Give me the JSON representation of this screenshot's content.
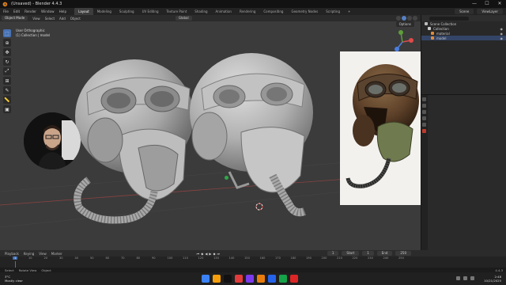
{
  "window": {
    "title": "(Unsaved) - Blender 4.4.3",
    "controls": [
      "—",
      "☐",
      "✕"
    ]
  },
  "menu": [
    "File",
    "Edit",
    "Render",
    "Window",
    "Help"
  ],
  "workspaces": [
    {
      "label": "Layout",
      "active": true
    },
    {
      "label": "Modeling",
      "active": false
    },
    {
      "label": "Sculpting",
      "active": false
    },
    {
      "label": "UV Editing",
      "active": false
    },
    {
      "label": "Texture Paint",
      "active": false
    },
    {
      "label": "Shading",
      "active": false
    },
    {
      "label": "Animation",
      "active": false
    },
    {
      "label": "Rendering",
      "active": false
    },
    {
      "label": "Compositing",
      "active": false
    },
    {
      "label": "Geometry Nodes",
      "active": false
    },
    {
      "label": "Scripting",
      "active": false
    },
    {
      "label": "+",
      "active": false
    }
  ],
  "scene": {
    "name": "Scene",
    "view_layer": "ViewLayer"
  },
  "viewport": {
    "mode": "Object Mode",
    "menu": [
      "View",
      "Select",
      "Add",
      "Object"
    ],
    "orientation": "Global",
    "options": "Options",
    "info_line1": "User Orthographic",
    "info_line2": "(1) Collection | model",
    "tools": [
      "select",
      "cursor",
      "move",
      "rotate",
      "scale",
      "transform",
      "annotate",
      "measure",
      "add-cube"
    ]
  },
  "outliner": {
    "rows": [
      {
        "label": "Scene Collection",
        "color": "#bbbbbb",
        "selected": false
      },
      {
        "label": "Collection",
        "color": "#cccccc",
        "selected": false
      },
      {
        "label": "material",
        "color": "#e08b3a",
        "selected": false
      },
      {
        "label": "model",
        "color": "#e08b3a",
        "selected": true
      }
    ]
  },
  "timeline": {
    "menu": [
      "Playback",
      "Keying",
      "View",
      "Marker"
    ],
    "current_frame": "1",
    "start_label": "Start",
    "start": "1",
    "end_label": "End",
    "end": "250",
    "ticks": [
      "10",
      "20",
      "30",
      "40",
      "50",
      "60",
      "70",
      "80",
      "90",
      "100",
      "110",
      "120",
      "130",
      "140",
      "150",
      "160",
      "170",
      "180",
      "190",
      "200",
      "210",
      "220",
      "230",
      "240",
      "250"
    ]
  },
  "statusbar": {
    "left": "Select",
    "middle": "Rotate View",
    "right": "Object",
    "version": "4.4.3"
  },
  "taskbar": {
    "temp": "3°C",
    "weather": "Mostly clear",
    "time": "2:48",
    "date": "10/21/2025",
    "app_colors": [
      "#3b82f6",
      "#f59e0b",
      "#111111",
      "#e23b3b",
      "#7c3aed",
      "#e87d0d",
      "#2563eb",
      "#16a34a",
      "#dc2626"
    ]
  }
}
